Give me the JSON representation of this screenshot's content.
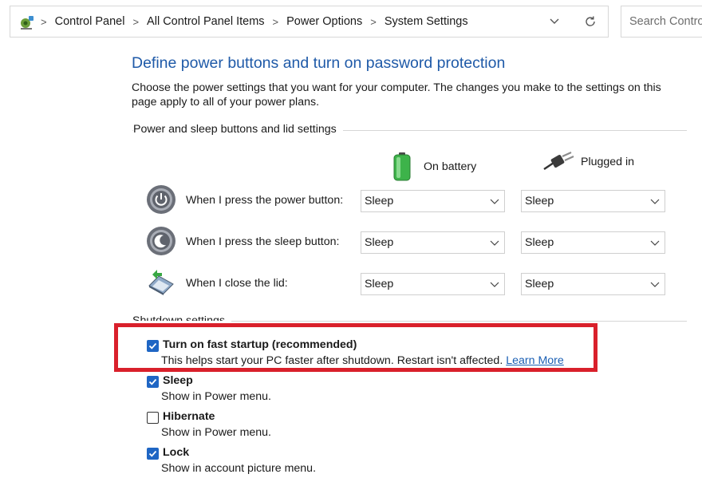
{
  "address_bar": {
    "breadcrumbs": [
      "Control Panel",
      "All Control Panel Items",
      "Power Options",
      "System Settings"
    ],
    "search_placeholder": "Search Control Panel"
  },
  "page": {
    "title": "Define power buttons and turn on password protection",
    "description": "Choose the power settings that you want for your computer. The changes you make to the settings on this page apply to all of your power plans."
  },
  "buttons_section": {
    "label": "Power and sleep buttons and lid settings",
    "columns": {
      "battery": "On battery",
      "plugged": "Plugged in"
    },
    "rows": [
      {
        "label": "When I press the power button:",
        "battery": "Sleep",
        "plugged": "Sleep",
        "icon": "power-button-icon"
      },
      {
        "label": "When I press the sleep button:",
        "battery": "Sleep",
        "plugged": "Sleep",
        "icon": "sleep-button-icon"
      },
      {
        "label": "When I close the lid:",
        "battery": "Sleep",
        "plugged": "Sleep",
        "icon": "laptop-lid-icon"
      }
    ]
  },
  "shutdown_section": {
    "label": "Shutdown settings",
    "options": [
      {
        "title": "Turn on fast startup (recommended)",
        "desc": "This helps start your PC faster after shutdown. Restart isn't affected.",
        "link": "Learn More",
        "checked": true
      },
      {
        "title": "Sleep",
        "desc": "Show in Power menu.",
        "checked": true
      },
      {
        "title": "Hibernate",
        "desc": "Show in Power menu.",
        "checked": false
      },
      {
        "title": "Lock",
        "desc": "Show in account picture menu.",
        "checked": true
      }
    ]
  },
  "colors": {
    "title": "#1f5aa8",
    "checkbox": "#1f66c4",
    "highlight": "#d9202b",
    "link": "#1a5fb4"
  }
}
